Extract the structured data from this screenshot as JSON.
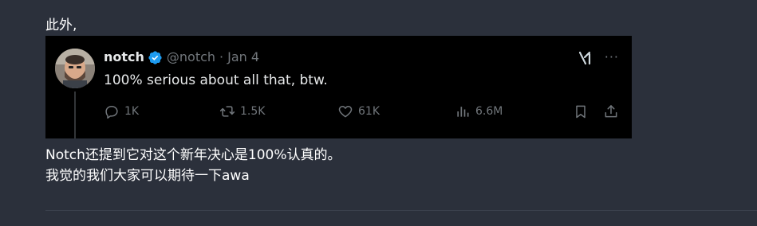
{
  "post": {
    "intro": "此外,",
    "body_line1": "Notch还提到它对这个新年决心是100%认真的。",
    "body_line2": "我觉的我们大家可以期待一下awa"
  },
  "tweet": {
    "name": "notch",
    "handle": "@notch",
    "separator": "·",
    "date": "Jan 4",
    "text": "100% serious about all that, btw.",
    "verified_color": "#1d9bf0",
    "more": "···",
    "actions": {
      "replies": "1K",
      "retweets": "1.5K",
      "likes": "61K",
      "views": "6.6M"
    },
    "icons": [
      "verified-badge-icon",
      "grok-icon",
      "more-icon",
      "reply-icon",
      "retweet-icon",
      "like-icon",
      "views-icon",
      "bookmark-icon",
      "share-icon"
    ]
  },
  "colors": {
    "page_bg": "#2b303b",
    "tweet_bg": "#000000",
    "muted": "#71767b",
    "text": "#e7e9ea"
  }
}
